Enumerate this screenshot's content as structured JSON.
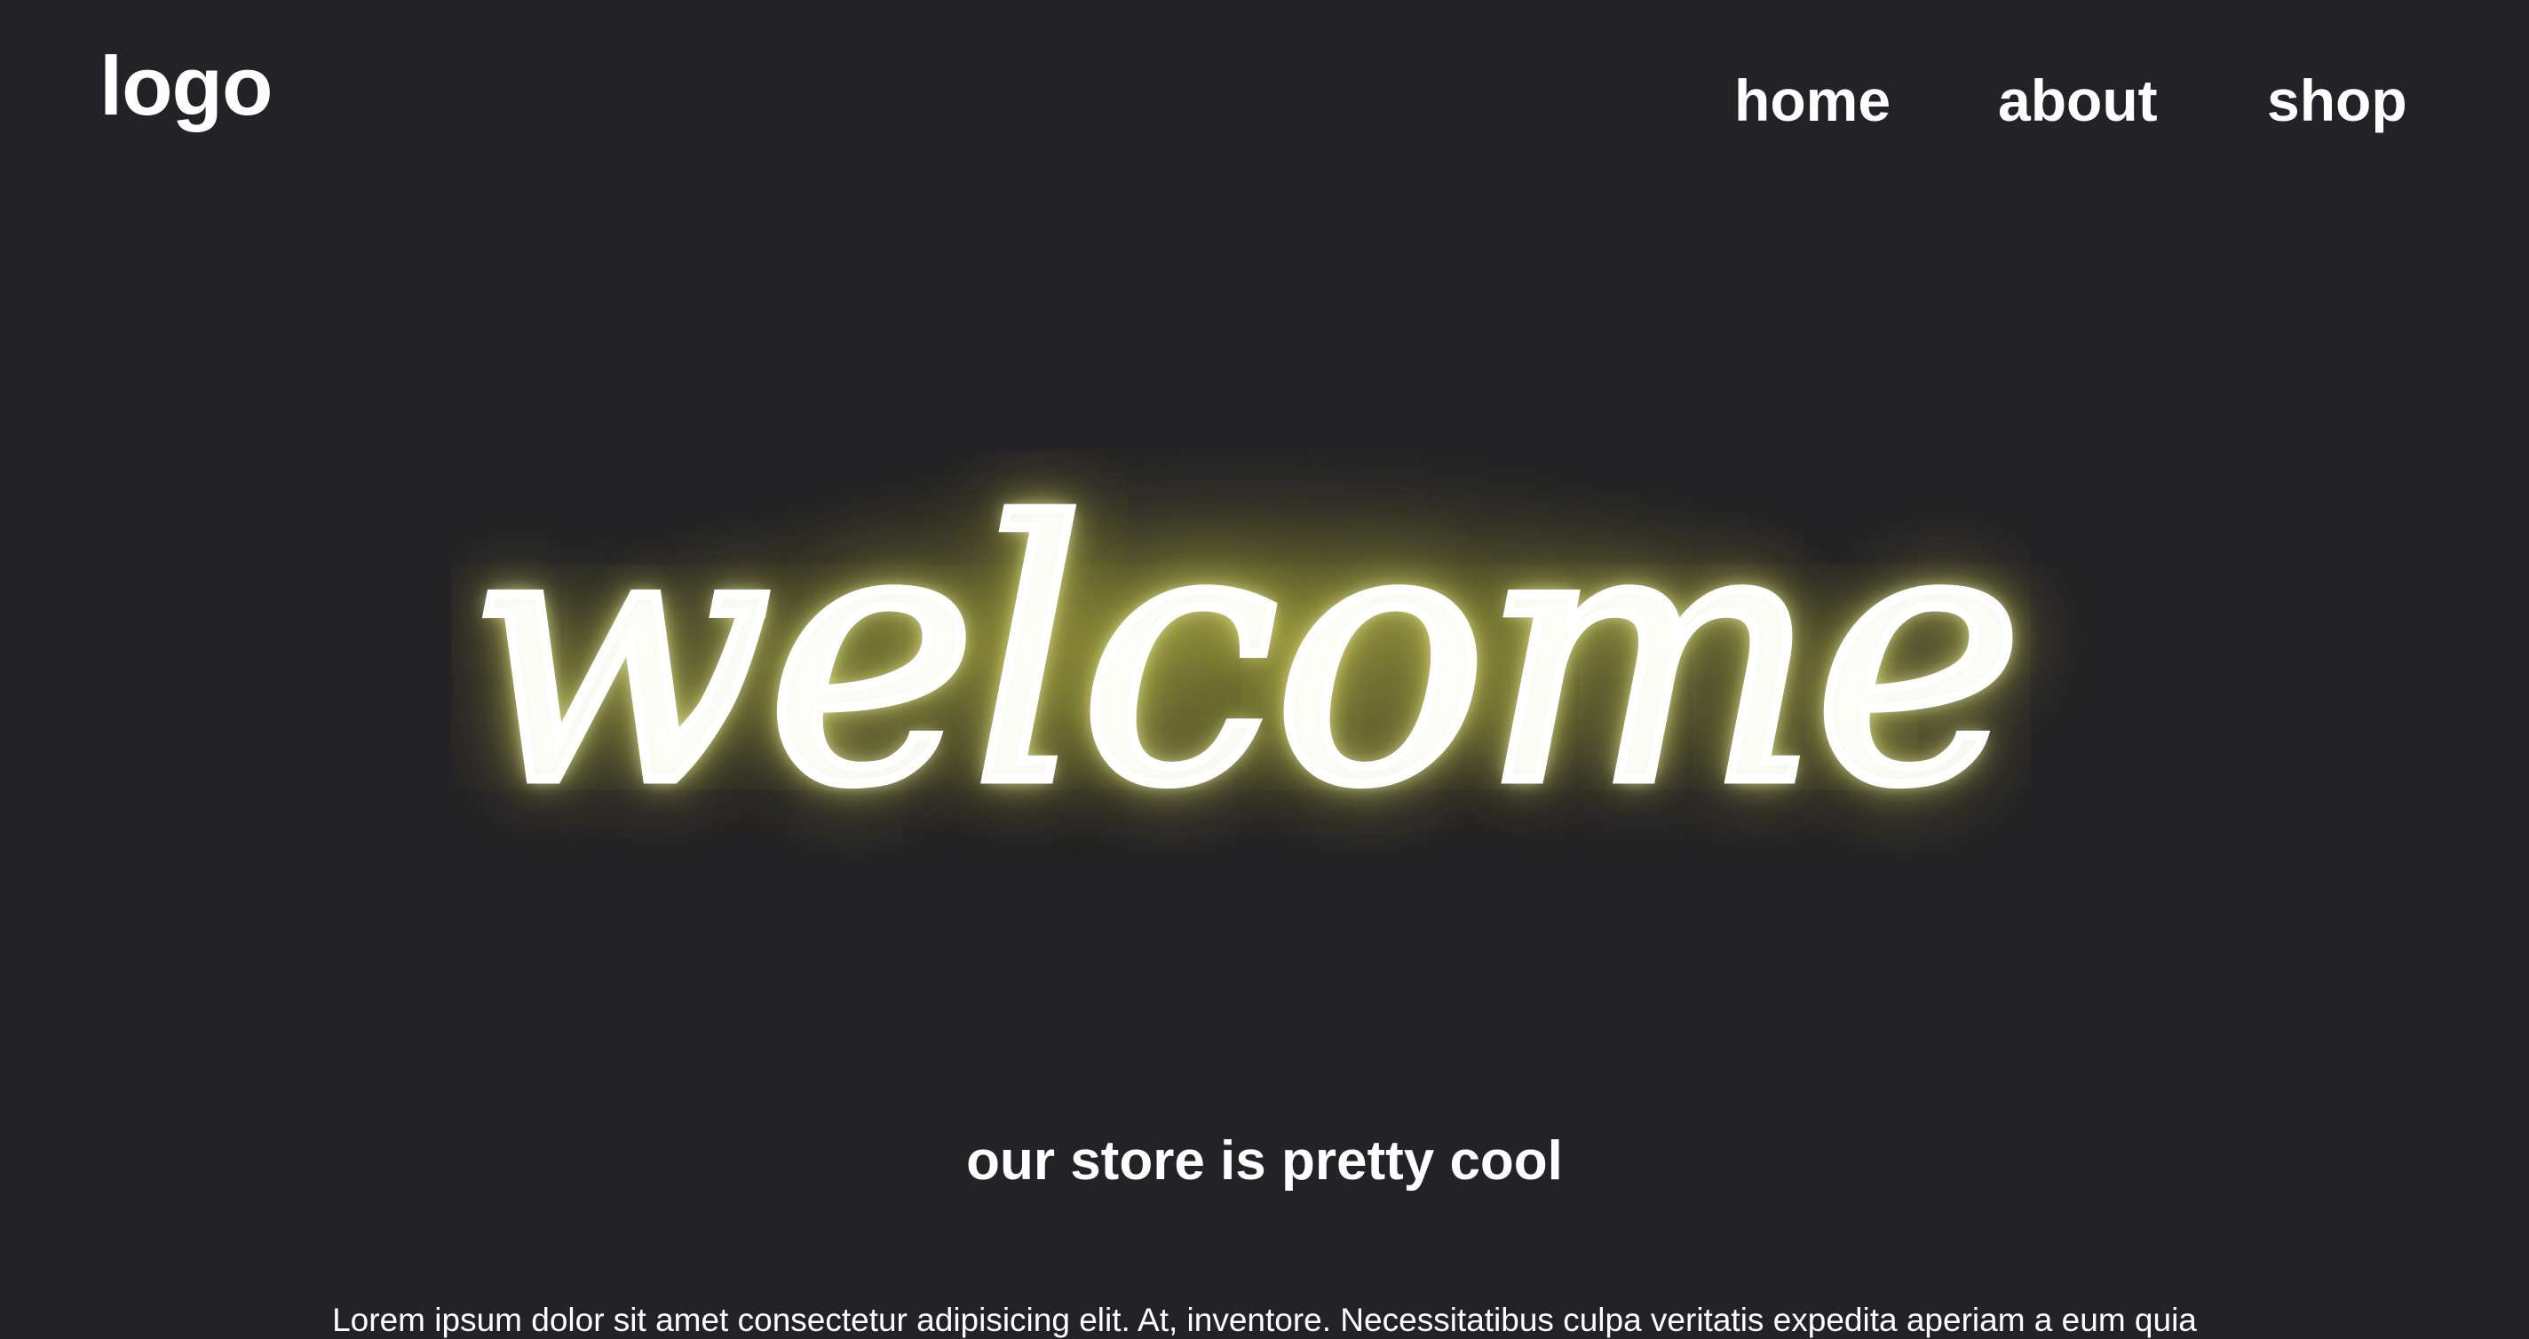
{
  "header": {
    "logo": "logo",
    "nav": {
      "home": "home",
      "about": "about",
      "shop": "shop"
    }
  },
  "hero": {
    "neon_text": "welcome",
    "glow_color": "#d6d65a"
  },
  "content": {
    "subtitle": "our store is pretty cool",
    "paragraph": "Lorem ipsum dolor sit amet consectetur adipisicing elit. At, inventore. Necessitatibus culpa veritatis expedita aperiam a eum quia"
  }
}
